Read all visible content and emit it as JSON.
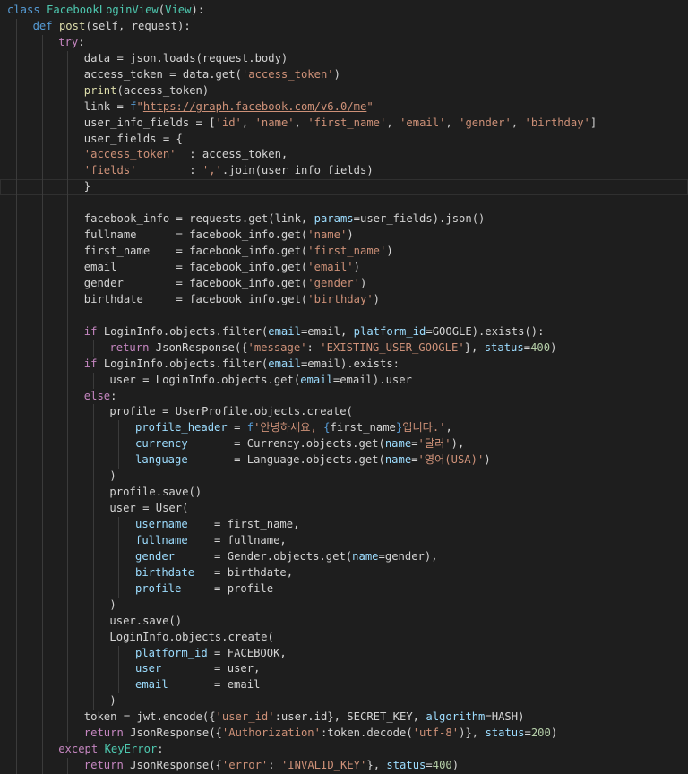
{
  "editor": {
    "language": "python",
    "colors": {
      "background": "#1e1e1e",
      "keyword": "#569cd6",
      "control": "#c586c0",
      "class": "#4ec9b0",
      "function": "#dcdcaa",
      "string": "#ce9178",
      "parameter": "#9cdcfe",
      "number": "#b5cea8",
      "plain": "#d4d4d4"
    },
    "lines": [
      {
        "indent": 0,
        "tokens": [
          [
            "kw",
            "class "
          ],
          [
            "cls",
            "FacebookLoginView"
          ],
          [
            "plain",
            "("
          ],
          [
            "cls",
            "View"
          ],
          [
            "plain",
            "):"
          ]
        ]
      },
      {
        "indent": 1,
        "tokens": [
          [
            "kw",
            "def "
          ],
          [
            "fn",
            "post"
          ],
          [
            "plain",
            "(self, request):"
          ]
        ]
      },
      {
        "indent": 2,
        "tokens": [
          [
            "ctrl",
            "try"
          ],
          [
            "plain",
            ":"
          ]
        ]
      },
      {
        "indent": 3,
        "tokens": [
          [
            "plain",
            "data = json.loads(request.body)"
          ]
        ]
      },
      {
        "indent": 3,
        "tokens": [
          [
            "plain",
            "access_token = data.get("
          ],
          [
            "str",
            "'access_token'"
          ],
          [
            "plain",
            ")"
          ]
        ]
      },
      {
        "indent": 3,
        "tokens": [
          [
            "fn",
            "print"
          ],
          [
            "plain",
            "(access_token)"
          ]
        ]
      },
      {
        "indent": 3,
        "tokens": [
          [
            "plain",
            "link = "
          ],
          [
            "kw",
            "f"
          ],
          [
            "str",
            "\""
          ],
          [
            "link",
            "https://graph.facebook.com/v6.0/me"
          ],
          [
            "str",
            "\""
          ]
        ]
      },
      {
        "indent": 3,
        "tokens": [
          [
            "plain",
            "user_info_fields = ["
          ],
          [
            "str",
            "'id'"
          ],
          [
            "plain",
            ", "
          ],
          [
            "str",
            "'name'"
          ],
          [
            "plain",
            ", "
          ],
          [
            "str",
            "'first_name'"
          ],
          [
            "plain",
            ", "
          ],
          [
            "str",
            "'email'"
          ],
          [
            "plain",
            ", "
          ],
          [
            "str",
            "'gender'"
          ],
          [
            "plain",
            ", "
          ],
          [
            "str",
            "'birthday'"
          ],
          [
            "plain",
            "]"
          ]
        ]
      },
      {
        "indent": 3,
        "tokens": [
          [
            "plain",
            "user_fields = {"
          ]
        ]
      },
      {
        "indent": 3,
        "tokens": [
          [
            "str",
            "'access_token'"
          ],
          [
            "plain",
            "  : access_token,"
          ]
        ]
      },
      {
        "indent": 3,
        "tokens": [
          [
            "str",
            "'fields'"
          ],
          [
            "plain",
            "        : "
          ],
          [
            "str",
            "','"
          ],
          [
            "plain",
            ".join(user_info_fields)"
          ]
        ]
      },
      {
        "indent": 3,
        "current": true,
        "tokens": [
          [
            "plain",
            "}"
          ]
        ]
      },
      {
        "indent": 3,
        "blank": true,
        "tokens": []
      },
      {
        "indent": 3,
        "tokens": [
          [
            "plain",
            "facebook_info = requests.get(link, "
          ],
          [
            "param",
            "params"
          ],
          [
            "plain",
            "=user_fields).json()"
          ]
        ]
      },
      {
        "indent": 3,
        "tokens": [
          [
            "plain",
            "fullname      = facebook_info.get("
          ],
          [
            "str",
            "'name'"
          ],
          [
            "plain",
            ")"
          ]
        ]
      },
      {
        "indent": 3,
        "tokens": [
          [
            "plain",
            "first_name    = facebook_info.get("
          ],
          [
            "str",
            "'first_name'"
          ],
          [
            "plain",
            ")"
          ]
        ]
      },
      {
        "indent": 3,
        "tokens": [
          [
            "plain",
            "email         = facebook_info.get("
          ],
          [
            "str",
            "'email'"
          ],
          [
            "plain",
            ")"
          ]
        ]
      },
      {
        "indent": 3,
        "tokens": [
          [
            "plain",
            "gender        = facebook_info.get("
          ],
          [
            "str",
            "'gender'"
          ],
          [
            "plain",
            ")"
          ]
        ]
      },
      {
        "indent": 3,
        "tokens": [
          [
            "plain",
            "birthdate     = facebook_info.get("
          ],
          [
            "str",
            "'birthday'"
          ],
          [
            "plain",
            ")"
          ]
        ]
      },
      {
        "indent": 3,
        "blank": true,
        "tokens": []
      },
      {
        "indent": 3,
        "tokens": [
          [
            "ctrl",
            "if "
          ],
          [
            "plain",
            "LoginInfo.objects.filter("
          ],
          [
            "param",
            "email"
          ],
          [
            "plain",
            "=email, "
          ],
          [
            "param",
            "platform_id"
          ],
          [
            "plain",
            "=GOOGLE).exists():"
          ]
        ]
      },
      {
        "indent": 4,
        "tokens": [
          [
            "ctrl",
            "return "
          ],
          [
            "plain",
            "JsonResponse({"
          ],
          [
            "str",
            "'message'"
          ],
          [
            "plain",
            ": "
          ],
          [
            "str",
            "'EXISTING_USER_GOOGLE'"
          ],
          [
            "plain",
            "}, "
          ],
          [
            "param",
            "status"
          ],
          [
            "plain",
            "="
          ],
          [
            "num",
            "400"
          ],
          [
            "plain",
            ")"
          ]
        ]
      },
      {
        "indent": 3,
        "tokens": [
          [
            "ctrl",
            "if "
          ],
          [
            "plain",
            "LoginInfo.objects.filter("
          ],
          [
            "param",
            "email"
          ],
          [
            "plain",
            "=email).exists:"
          ]
        ]
      },
      {
        "indent": 4,
        "tokens": [
          [
            "plain",
            "user = LoginInfo.objects.get("
          ],
          [
            "param",
            "email"
          ],
          [
            "plain",
            "=email).user"
          ]
        ]
      },
      {
        "indent": 3,
        "tokens": [
          [
            "ctrl",
            "else"
          ],
          [
            "plain",
            ":"
          ]
        ]
      },
      {
        "indent": 4,
        "tokens": [
          [
            "plain",
            "profile = UserProfile.objects.create("
          ]
        ]
      },
      {
        "indent": 5,
        "tokens": [
          [
            "param",
            "profile_header"
          ],
          [
            "plain",
            " = "
          ],
          [
            "kw",
            "f"
          ],
          [
            "str",
            "'안녕하세요, "
          ],
          [
            "kw",
            "{"
          ],
          [
            "plain",
            "first_name"
          ],
          [
            "kw",
            "}"
          ],
          [
            "str",
            "입니다.'"
          ],
          [
            "plain",
            ","
          ]
        ]
      },
      {
        "indent": 5,
        "tokens": [
          [
            "param",
            "currency"
          ],
          [
            "plain",
            "       = Currency.objects.get("
          ],
          [
            "param",
            "name"
          ],
          [
            "plain",
            "="
          ],
          [
            "str",
            "'달러'"
          ],
          [
            "plain",
            "),"
          ]
        ]
      },
      {
        "indent": 5,
        "tokens": [
          [
            "param",
            "language"
          ],
          [
            "plain",
            "       = Language.objects.get("
          ],
          [
            "param",
            "name"
          ],
          [
            "plain",
            "="
          ],
          [
            "str",
            "'영어(USA)'"
          ],
          [
            "plain",
            ")"
          ]
        ]
      },
      {
        "indent": 4,
        "tokens": [
          [
            "plain",
            ")"
          ]
        ]
      },
      {
        "indent": 4,
        "tokens": [
          [
            "plain",
            "profile.save()"
          ]
        ]
      },
      {
        "indent": 4,
        "tokens": [
          [
            "plain",
            "user = User("
          ]
        ]
      },
      {
        "indent": 5,
        "tokens": [
          [
            "param",
            "username"
          ],
          [
            "plain",
            "    = first_name,"
          ]
        ]
      },
      {
        "indent": 5,
        "tokens": [
          [
            "param",
            "fullname"
          ],
          [
            "plain",
            "    = fullname,"
          ]
        ]
      },
      {
        "indent": 5,
        "tokens": [
          [
            "param",
            "gender"
          ],
          [
            "plain",
            "      = Gender.objects.get("
          ],
          [
            "param",
            "name"
          ],
          [
            "plain",
            "=gender),"
          ]
        ]
      },
      {
        "indent": 5,
        "tokens": [
          [
            "param",
            "birthdate"
          ],
          [
            "plain",
            "   = birthdate,"
          ]
        ]
      },
      {
        "indent": 5,
        "tokens": [
          [
            "param",
            "profile"
          ],
          [
            "plain",
            "     = profile"
          ]
        ]
      },
      {
        "indent": 4,
        "tokens": [
          [
            "plain",
            ")"
          ]
        ]
      },
      {
        "indent": 4,
        "tokens": [
          [
            "plain",
            "user.save()"
          ]
        ]
      },
      {
        "indent": 4,
        "tokens": [
          [
            "plain",
            "LoginInfo.objects.create("
          ]
        ]
      },
      {
        "indent": 5,
        "tokens": [
          [
            "param",
            "platform_id"
          ],
          [
            "plain",
            " = FACEBOOK,"
          ]
        ]
      },
      {
        "indent": 5,
        "tokens": [
          [
            "param",
            "user"
          ],
          [
            "plain",
            "        = user,"
          ]
        ]
      },
      {
        "indent": 5,
        "tokens": [
          [
            "param",
            "email"
          ],
          [
            "plain",
            "       = email"
          ]
        ]
      },
      {
        "indent": 4,
        "tokens": [
          [
            "plain",
            ")"
          ]
        ]
      },
      {
        "indent": 3,
        "tokens": [
          [
            "plain",
            "token = jwt.encode({"
          ],
          [
            "str",
            "'user_id'"
          ],
          [
            "plain",
            ":user.id}, SECRET_KEY, "
          ],
          [
            "param",
            "algorithm"
          ],
          [
            "plain",
            "=HASH)"
          ]
        ]
      },
      {
        "indent": 3,
        "tokens": [
          [
            "ctrl",
            "return "
          ],
          [
            "plain",
            "JsonResponse({"
          ],
          [
            "str",
            "'Authorization'"
          ],
          [
            "plain",
            ":token.decode("
          ],
          [
            "str",
            "'utf-8'"
          ],
          [
            "plain",
            ")}, "
          ],
          [
            "param",
            "status"
          ],
          [
            "plain",
            "="
          ],
          [
            "num",
            "200"
          ],
          [
            "plain",
            ")"
          ]
        ]
      },
      {
        "indent": 2,
        "tokens": [
          [
            "ctrl",
            "except "
          ],
          [
            "cls",
            "KeyError"
          ],
          [
            "plain",
            ":"
          ]
        ]
      },
      {
        "indent": 3,
        "tokens": [
          [
            "ctrl",
            "return "
          ],
          [
            "plain",
            "JsonResponse({"
          ],
          [
            "str",
            "'error'"
          ],
          [
            "plain",
            ": "
          ],
          [
            "str",
            "'INVALID_KEY'"
          ],
          [
            "plain",
            "}, "
          ],
          [
            "param",
            "status"
          ],
          [
            "plain",
            "="
          ],
          [
            "num",
            "400"
          ],
          [
            "plain",
            ")"
          ]
        ]
      }
    ]
  }
}
